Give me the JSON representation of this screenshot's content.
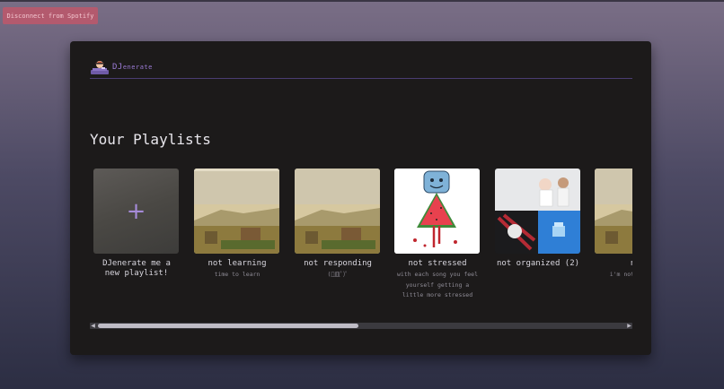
{
  "top_button": {
    "label": "Disconnect from Spotify"
  },
  "brand": {
    "title_main": "DJ",
    "title_small": "enerate"
  },
  "heading": "Your Playlists",
  "playlists": [
    {
      "title": "DJenerate me a new playlist!",
      "subtitle": "",
      "icon": "plus-icon"
    },
    {
      "title": "not learning",
      "subtitle": "time to learn"
    },
    {
      "title": "not responding",
      "subtitle": "(ﾟ皿ﾟ)ﾟ"
    },
    {
      "title": "not stressed",
      "subtitle": "with each song you feel yourself getting a little more stressed"
    },
    {
      "title": "not organized (2)",
      "subtitle": ""
    },
    {
      "title": "not",
      "subtitle": "i'm not cr... cr"
    }
  ],
  "scrollbar": {
    "left_arrow": "◀",
    "right_arrow": "▶",
    "position_fraction": 0.0
  },
  "colors": {
    "accent": "#9b7bd6",
    "button": "#b35a6e",
    "panel": "#1c1a1a"
  }
}
